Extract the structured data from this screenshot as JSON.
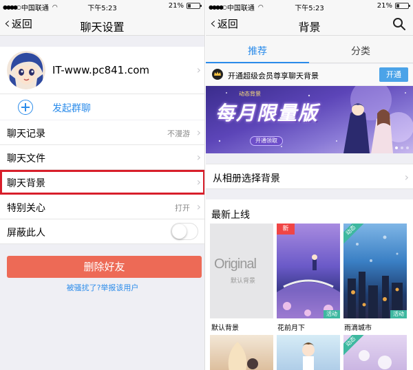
{
  "status_bar": {
    "carrier": "中国联通",
    "time": "下午5:23",
    "battery": "21%"
  },
  "left_screen": {
    "nav": {
      "back_label": "返回",
      "title": "聊天设置"
    },
    "profile": {
      "name": "IT-www.pc841.com"
    },
    "group_chat": {
      "label": "发起群聊"
    },
    "menu": [
      {
        "label": "聊天记录",
        "value": "不漫游"
      },
      {
        "label": "聊天文件",
        "value": ""
      },
      {
        "label": "聊天背景",
        "value": ""
      },
      {
        "label": "特别关心",
        "value": "打开"
      },
      {
        "label": "屏蔽此人",
        "value": ""
      }
    ],
    "block_toggle_on": false,
    "delete_button": "删除好友",
    "report_link": "被骚扰了?举报该用户"
  },
  "right_screen": {
    "nav": {
      "back_label": "返回",
      "title": "背景"
    },
    "tabs": [
      {
        "label": "推荐",
        "active": true
      },
      {
        "label": "分类",
        "active": false
      }
    ],
    "vip": {
      "text": "开通超级会员尊享聊天背景",
      "button": "开通"
    },
    "banner": {
      "small": "动态背景",
      "big": "每月限量版",
      "button": "开通领取"
    },
    "album_row": "从相册选择背景",
    "latest_title": "最新上线",
    "thumbnails": [
      {
        "label": "默认背景",
        "original_big": "Original",
        "original_small": "默认背景",
        "corner": ""
      },
      {
        "label": "花前月下",
        "corner": "新",
        "bottom_badge": "活动"
      },
      {
        "label": "雨滴城市",
        "corner": "动态",
        "bottom_badge": "活动"
      }
    ],
    "second_row_badges": [
      "动态"
    ]
  },
  "colors": {
    "accent_blue": "#2a8bea",
    "delete_red": "#ed6a56",
    "highlight_red": "#d81e2a",
    "vip_button": "#4ba3e8"
  }
}
